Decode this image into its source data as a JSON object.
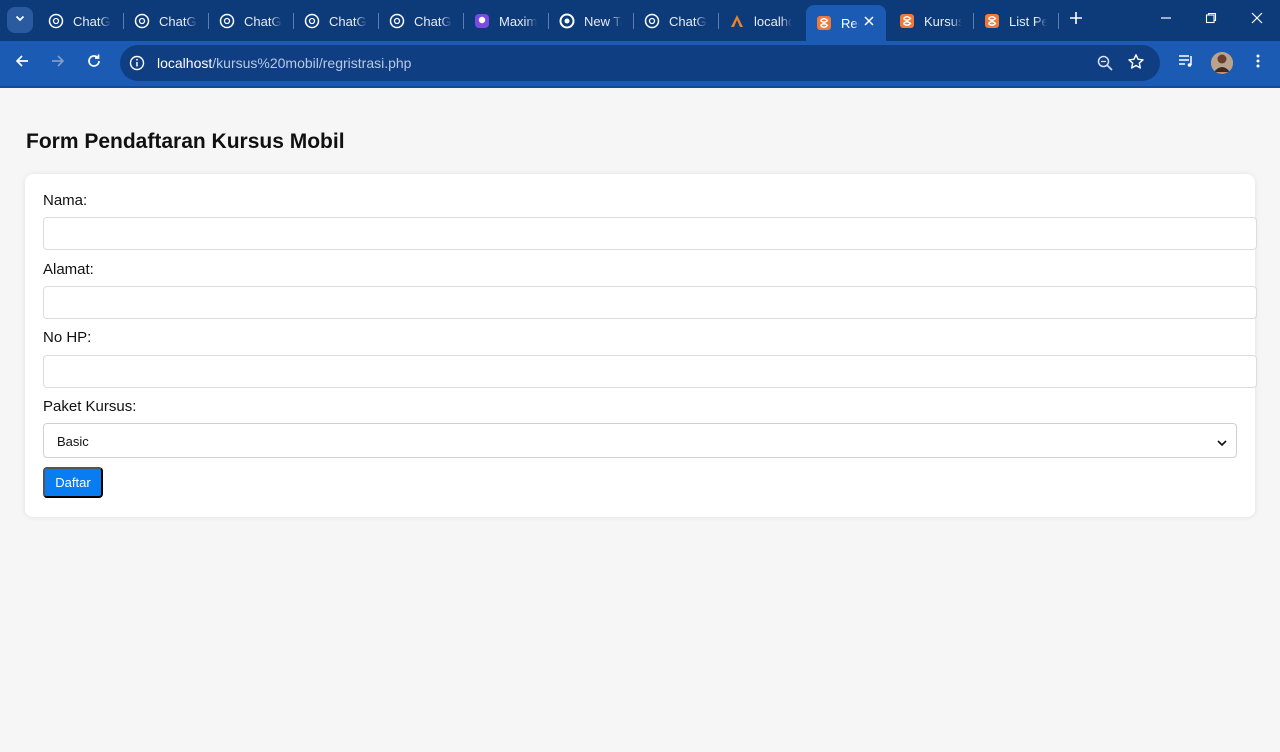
{
  "browser": {
    "tabs": [
      {
        "title": "ChatGPT",
        "icon": "chatgpt-icon"
      },
      {
        "title": "ChatGPT",
        "icon": "chatgpt-icon"
      },
      {
        "title": "ChatGPT",
        "icon": "chatgpt-icon"
      },
      {
        "title": "ChatGPT",
        "icon": "chatgpt-icon"
      },
      {
        "title": "ChatGPT",
        "icon": "chatgpt-icon"
      },
      {
        "title": "Maxim",
        "icon": "maxim-icon"
      },
      {
        "title": "New Tab",
        "icon": "chrome-icon"
      },
      {
        "title": "ChatGPT",
        "icon": "chatgpt-icon"
      },
      {
        "title": "localhost",
        "icon": "xampp-icon"
      },
      {
        "title": "Regristrasi",
        "icon": "xampp-icon",
        "active": true
      },
      {
        "title": "Kursus",
        "icon": "xampp-icon"
      },
      {
        "title": "List Pendaftar",
        "icon": "xampp-icon"
      }
    ],
    "url_host": "localhost",
    "url_path": "/kursus%20mobil/regristrasi.php",
    "colors": {
      "tabstrip": "#0d3a78",
      "toolbar": "#1b5bb4",
      "omnibox": "#0f3f82"
    }
  },
  "page": {
    "title": "Form Pendaftaran Kursus Mobil",
    "fields": {
      "nama_label": "Nama:",
      "nama_value": "",
      "alamat_label": "Alamat:",
      "alamat_value": "",
      "nohp_label": "No HP:",
      "nohp_value": "",
      "paket_label": "Paket Kursus:",
      "paket_selected": "Basic"
    },
    "submit_label": "Daftar",
    "colors": {
      "button": "#0a7cf2",
      "background": "#f6f6f6"
    }
  }
}
